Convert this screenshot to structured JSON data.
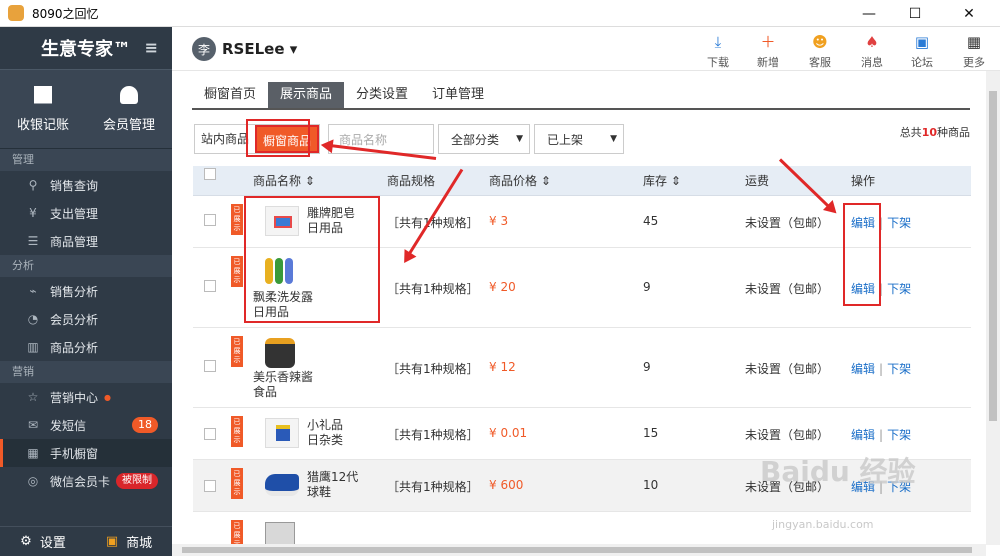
{
  "window": {
    "title": "8090之回忆",
    "minimize": "—",
    "maximize": "☐",
    "close": "✕"
  },
  "sidebar": {
    "brand": "生意专家™",
    "menu_icon": "≡",
    "quick": [
      {
        "label": "收银记账",
        "icon": "calculator-icon"
      },
      {
        "label": "会员管理",
        "icon": "user-icon"
      }
    ],
    "sections": [
      {
        "title": "管理",
        "items": [
          {
            "label": "销售查询",
            "icon": "search-icon",
            "glyph": "⚲"
          },
          {
            "label": "支出管理",
            "icon": "yen-icon",
            "glyph": "¥"
          },
          {
            "label": "商品管理",
            "icon": "list-icon",
            "glyph": "☰"
          }
        ]
      },
      {
        "title": "分析",
        "items": [
          {
            "label": "销售分析",
            "icon": "trend-icon",
            "glyph": "⌁"
          },
          {
            "label": "会员分析",
            "icon": "pie-icon",
            "glyph": "◔"
          },
          {
            "label": "商品分析",
            "icon": "bar-icon",
            "glyph": "▥"
          }
        ]
      },
      {
        "title": "营销",
        "items": [
          {
            "label": "营销中心",
            "icon": "star-icon",
            "glyph": "☆",
            "dot": "●"
          },
          {
            "label": "发短信",
            "icon": "mail-icon",
            "glyph": "✉",
            "badge": "18"
          },
          {
            "label": "手机橱窗",
            "icon": "qrcode-icon",
            "glyph": "▦",
            "active": true
          },
          {
            "label": "微信会员卡",
            "icon": "wechat-icon",
            "glyph": "◎",
            "badge": "被限制"
          }
        ]
      }
    ],
    "bottom": [
      {
        "label": "设置",
        "icon": "gear-icon",
        "glyph": "⚙"
      },
      {
        "label": "商城",
        "icon": "bag-icon",
        "glyph": "🔒"
      }
    ]
  },
  "topbar": {
    "avatar": "李",
    "username": "RSELee ▾",
    "tools": [
      {
        "label": "下载",
        "icon": "download-icon",
        "glyph": "⤓",
        "color": "#2a7bd6"
      },
      {
        "label": "新增",
        "icon": "plus-icon",
        "glyph": "＋",
        "color": "#f05a28"
      },
      {
        "label": "客服",
        "icon": "support-icon",
        "glyph": "☻",
        "color": "#f0a020"
      },
      {
        "label": "消息",
        "icon": "bell-icon",
        "glyph": "🔔",
        "color": "#e04040"
      },
      {
        "label": "论坛",
        "icon": "chat-icon",
        "glyph": "▣",
        "color": "#2a7bd6"
      },
      {
        "label": "更多",
        "icon": "grid-icon",
        "glyph": "▦",
        "color": "#333333"
      }
    ]
  },
  "tabs": [
    {
      "label": "橱窗首页"
    },
    {
      "label": "展示商品",
      "active": true
    },
    {
      "label": "分类设置"
    },
    {
      "label": "订单管理"
    }
  ],
  "filters": {
    "scope": [
      "站内商品",
      "橱窗商品"
    ],
    "search_placeholder": "商品名称",
    "category": "全部分类",
    "status": "已上架",
    "total_prefix": "总共",
    "total_count": "10",
    "total_suffix": "种商品"
  },
  "table": {
    "headers": [
      "商品名称 ⇕",
      "商品规格",
      "商品价格 ⇕",
      "库存 ⇕",
      "运费",
      "操作"
    ],
    "tag": "已展示",
    "rows": [
      {
        "name": "雕牌肥皂",
        "category": "日用品",
        "spec": "［共有1种规格］",
        "price": "¥ 3",
        "stock": "45",
        "shipping": "未设置（包邮）",
        "edit": "编辑",
        "off": "下架"
      },
      {
        "name": "飘柔洗发露",
        "category": "日用品",
        "spec": "［共有1种规格］",
        "price": "¥ 20",
        "stock": "9",
        "shipping": "未设置（包邮）",
        "edit": "编辑",
        "off": "下架"
      },
      {
        "name": "美乐香辣酱",
        "category": "食品",
        "spec": "［共有1种规格］",
        "price": "¥ 12",
        "stock": "9",
        "shipping": "未设置（包邮）",
        "edit": "编辑",
        "off": "下架"
      },
      {
        "name": "小礼品",
        "category": "日杂类",
        "spec": "［共有1种规格］",
        "price": "¥ 0.01",
        "stock": "15",
        "shipping": "未设置（包邮）",
        "edit": "编辑",
        "off": "下架"
      },
      {
        "name": "猎鹰12代",
        "category": "球鞋",
        "spec": "［共有1种规格］",
        "price": "¥ 600",
        "stock": "10",
        "shipping": "未设置（包邮）",
        "edit": "编辑",
        "off": "下架"
      }
    ]
  },
  "watermark": {
    "brand": "Baidu 经验",
    "url": "jingyan.baidu.com"
  }
}
